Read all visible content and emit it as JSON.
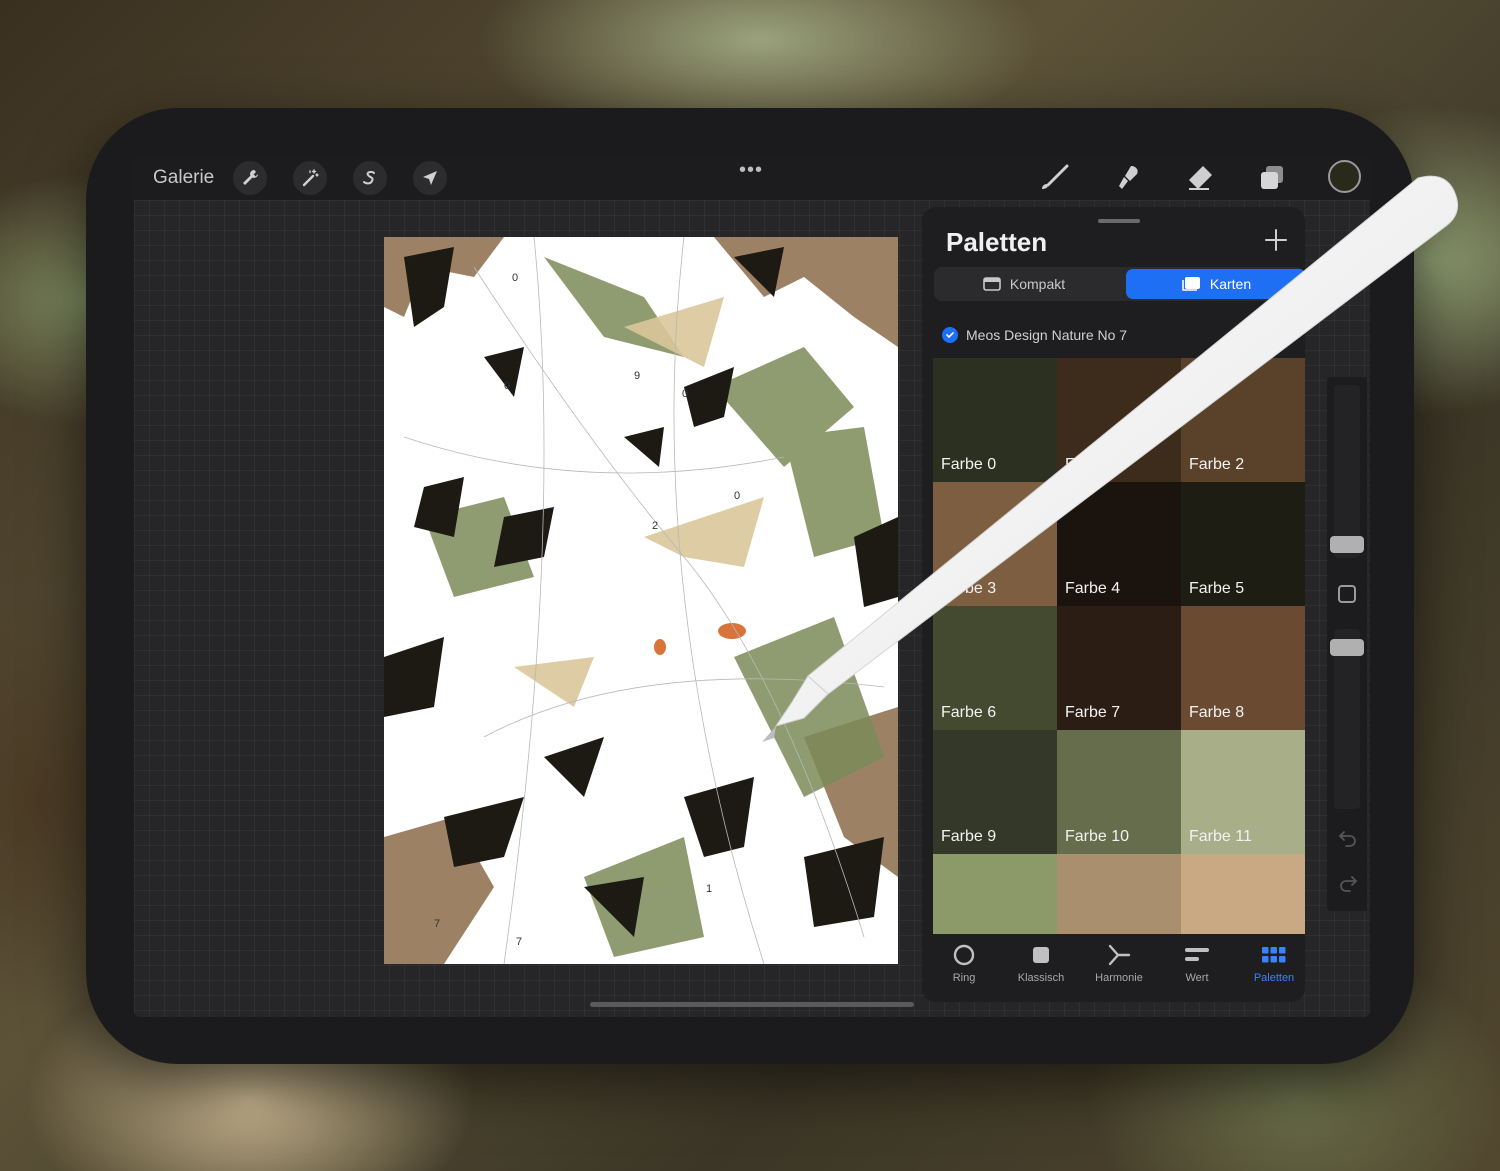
{
  "toolbar": {
    "gallery_label": "Galerie",
    "more_label": "•••",
    "current_color": "#2a2a1c"
  },
  "panel": {
    "title": "Paletten",
    "view_modes": [
      {
        "label": "Kompakt",
        "active": false
      },
      {
        "label": "Karten",
        "active": true
      }
    ],
    "palette_name": "Meos Design Nature No 7",
    "swatches": [
      {
        "label": "Farbe 0",
        "color": "#2b3020"
      },
      {
        "label": "Farbe 1",
        "color": "#3d2c1c"
      },
      {
        "label": "Farbe 2",
        "color": "#5a4129"
      },
      {
        "label": "Farbe 3",
        "color": "#7d5e40"
      },
      {
        "label": "Farbe 4",
        "color": "#1a130e"
      },
      {
        "label": "Farbe 5",
        "color": "#1d1d14"
      },
      {
        "label": "Farbe 6",
        "color": "#434a30"
      },
      {
        "label": "Farbe 7",
        "color": "#2b1d14"
      },
      {
        "label": "Farbe 8",
        "color": "#6a4b31"
      },
      {
        "label": "Farbe 9",
        "color": "#343828"
      },
      {
        "label": "Farbe 10",
        "color": "#666d4c"
      },
      {
        "label": "Farbe 11",
        "color": "#a8af88"
      },
      {
        "label": "",
        "color": "#8c9a6a"
      },
      {
        "label": "",
        "color": "#a98f6e"
      },
      {
        "label": "",
        "color": "#c9a884"
      }
    ],
    "tabs": [
      {
        "label": "Ring",
        "icon": "ring-icon"
      },
      {
        "label": "Klassisch",
        "icon": "classic-icon"
      },
      {
        "label": "Harmonie",
        "icon": "harmony-icon"
      },
      {
        "label": "Wert",
        "icon": "value-icon"
      },
      {
        "label": "Paletten",
        "icon": "palettes-icon",
        "active": true
      }
    ]
  },
  "canvas": {
    "numbers": [
      "0",
      "0",
      "0",
      "9",
      "2",
      "0",
      "7",
      "1",
      "7"
    ]
  },
  "colors": {
    "accent": "#1f6ff5"
  }
}
